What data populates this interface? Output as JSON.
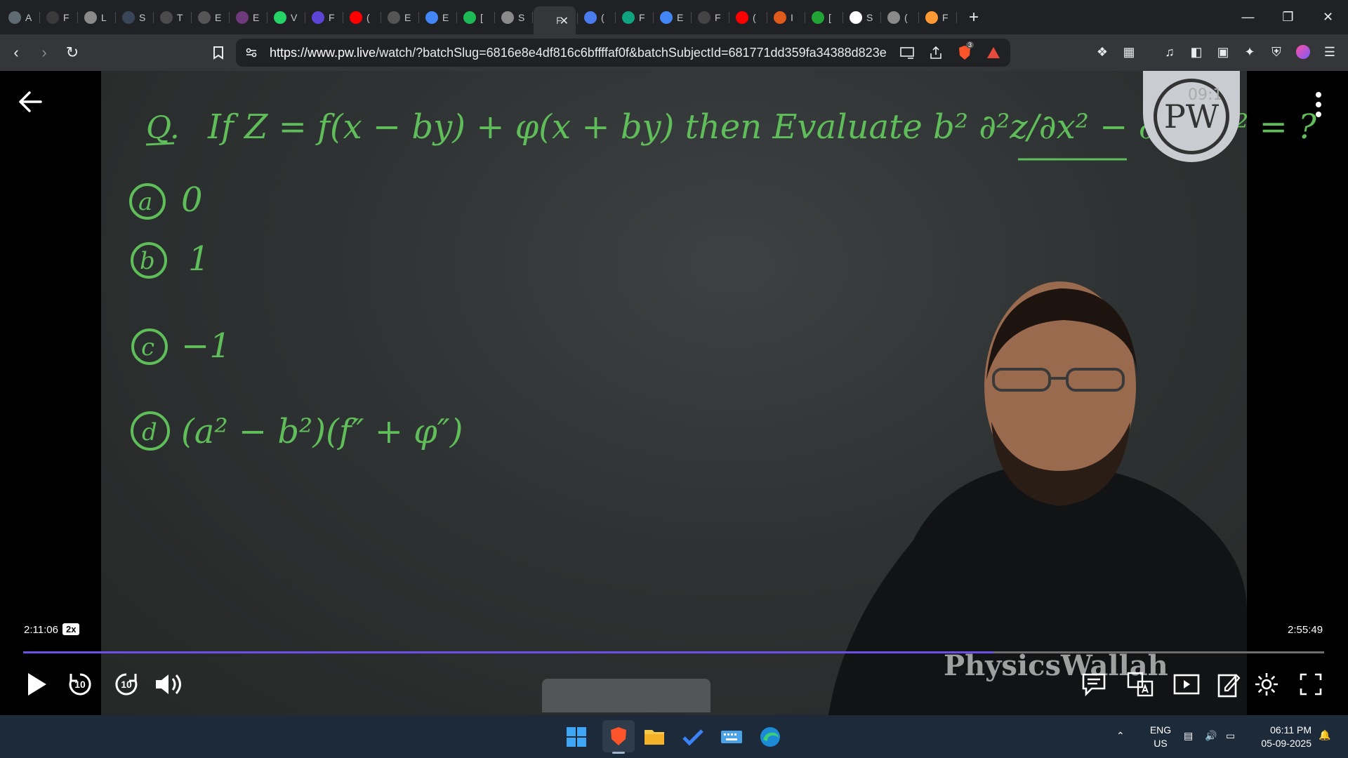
{
  "tabs": [
    {
      "initial": "A",
      "icon": "chat-icon",
      "color": "#5f6b73"
    },
    {
      "initial": "F",
      "icon": "bitcoin-icon",
      "color": "#3a3a3a"
    },
    {
      "initial": "L",
      "icon": "globe-icon",
      "color": "#8a8a8a"
    },
    {
      "initial": "S",
      "icon": "grid-icon",
      "color": "#39465a"
    },
    {
      "initial": "T",
      "icon": "w3-icon",
      "color": "#4b4b4b"
    },
    {
      "initial": "E",
      "icon": "ms-icon",
      "color": "#555555"
    },
    {
      "initial": "E",
      "icon": "circle-logo-icon",
      "color": "#6c3a7a"
    },
    {
      "initial": "V",
      "icon": "whatsapp-icon",
      "color": "#25d366"
    },
    {
      "initial": "F",
      "icon": "bookmark-logo-icon",
      "color": "#5b44d6"
    },
    {
      "initial": "(",
      "icon": "youtube-icon",
      "color": "#ff0000"
    },
    {
      "initial": "E",
      "icon": "oriz-icon",
      "color": "#555555"
    },
    {
      "initial": "E",
      "icon": "google-icon",
      "color": "#4285f4"
    },
    {
      "initial": "[",
      "icon": "spotify-icon",
      "color": "#1db954"
    },
    {
      "initial": "S",
      "icon": "globe-icon",
      "color": "#8a8a8a"
    },
    {
      "initial": "F",
      "icon": "pw-icon",
      "color": "#35363a",
      "active": true
    },
    {
      "initial": "(",
      "icon": "gemini-icon",
      "color": "#4a7cf0"
    },
    {
      "initial": "F",
      "icon": "chatgpt-icon",
      "color": "#10a37f"
    },
    {
      "initial": "E",
      "icon": "google-icon",
      "color": "#4285f4"
    },
    {
      "initial": "F",
      "icon": "monitor-icon",
      "color": "#444444"
    },
    {
      "initial": "(",
      "icon": "youtube-icon",
      "color": "#ff0000"
    },
    {
      "initial": "I",
      "icon": "ball-icon",
      "color": "#e05a1c"
    },
    {
      "initial": "[",
      "icon": "stats-icon",
      "color": "#21a336"
    },
    {
      "initial": "S",
      "icon": "wikipedia-icon",
      "color": "#ffffff"
    },
    {
      "initial": "(",
      "icon": "globe-icon",
      "color": "#8a8a8a"
    },
    {
      "initial": "F",
      "icon": "india-flag-icon",
      "color": "#ff9933"
    }
  ],
  "toolbar": {
    "url_host": "https://www.pw.live",
    "url_rest": "/watch/?batchSlug=6816e8e4df816c6bffffaf0f&batchSubjectId=681771dd359fa34388d823e...",
    "brave_badge": "3"
  },
  "board": {
    "question_label": "Q.",
    "question": "If Z = f(x − by) + φ(x + by) then Evaluate b² ∂²z/∂x² − ∂²z/∂y² = ?",
    "options": [
      {
        "label": "a",
        "text": "0"
      },
      {
        "label": "b",
        "text": "1"
      },
      {
        "label": "c",
        "text": "−1"
      },
      {
        "label": "d",
        "text": "(a² − b²)(f″ + φ″)"
      }
    ],
    "logo_text": "PW",
    "logo_overlay": "09:1",
    "watermark": "PhysicsWallah"
  },
  "player": {
    "current_time": "2:11:06",
    "speed": "2x",
    "duration": "2:55:49",
    "progress": 0.7458,
    "skip_back": "10",
    "skip_forward": "10",
    "accent": "#6c4fe6"
  },
  "taskbar": {
    "lang_line1": "ENG",
    "lang_line2": "US",
    "time": "06:11 PM",
    "date": "05-09-2025"
  }
}
